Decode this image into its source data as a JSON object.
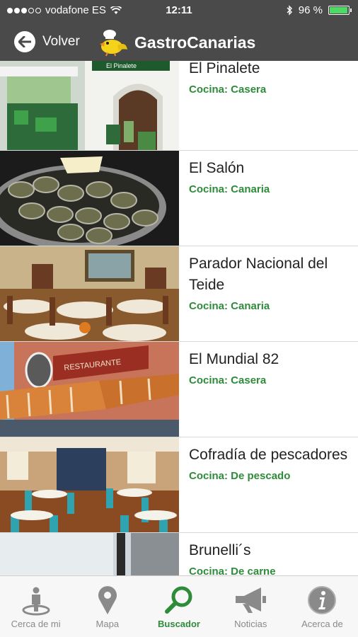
{
  "status": {
    "carrier": "vodafone ES",
    "time": "12:11",
    "battery": "96 %",
    "battery_level": 0.96
  },
  "header": {
    "back_label": "Volver",
    "app_title": "GastroCanarias"
  },
  "restaurants": [
    {
      "name": "El Pinalete",
      "cuisine": "Cocina: Casera",
      "sign": "El Pinalete"
    },
    {
      "name": "El Salón",
      "cuisine": "Cocina: Canaria"
    },
    {
      "name": "Parador Nacional del Teide",
      "cuisine": "Cocina: Canaria"
    },
    {
      "name": "El Mundial 82",
      "cuisine": "Cocina: Casera",
      "sign": "RESTAURANTE"
    },
    {
      "name": "Cofradía de pescadores",
      "cuisine": "Cocina: De pescado"
    },
    {
      "name": "Brunelli´s",
      "cuisine": "Cocina: De carne"
    }
  ],
  "tabs": [
    {
      "label": "Cerca de mi",
      "icon": "location-person-icon"
    },
    {
      "label": "Mapa",
      "icon": "map-pin-icon"
    },
    {
      "label": "Buscador",
      "icon": "search-icon"
    },
    {
      "label": "Noticias",
      "icon": "megaphone-icon"
    },
    {
      "label": "Acerca de",
      "icon": "info-icon"
    }
  ],
  "colors": {
    "header_bg": "#4a4a4a",
    "accent_green": "#2e8b3a",
    "tab_inactive": "#8a8a8a"
  }
}
